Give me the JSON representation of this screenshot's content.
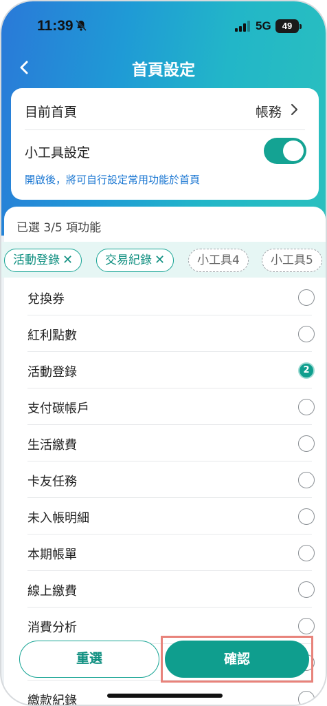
{
  "status_bar": {
    "time": "11:39",
    "network": "5G",
    "battery": "49",
    "icons": [
      "bell-muted-icon",
      "signal-icon"
    ]
  },
  "nav": {
    "title": "首頁設定",
    "back_icon": "chevron-left-icon"
  },
  "settings": {
    "home_label": "目前首頁",
    "home_value": "帳務",
    "widget_label": "小工具設定",
    "widget_enabled": true,
    "hint": "開啟後，將可自行設定常用功能於首頁"
  },
  "selection": {
    "count_text": "已選 3/5 項功能",
    "chips": [
      {
        "label": "活動登錄",
        "remove": "✕",
        "selected": true
      },
      {
        "label": "交易紀錄",
        "remove": "✕",
        "selected": true
      },
      {
        "label": "小工具4",
        "selected": false
      },
      {
        "label": "小工具5",
        "selected": false
      }
    ]
  },
  "features": [
    {
      "name": "兌換券",
      "checked": false
    },
    {
      "name": "紅利點數",
      "checked": false
    },
    {
      "name": "活動登錄",
      "checked": true,
      "order": "2"
    },
    {
      "name": "支付碳帳戶",
      "checked": false
    },
    {
      "name": "生活繳費",
      "checked": false
    },
    {
      "name": "卡友任務",
      "checked": false
    },
    {
      "name": "未入帳明細",
      "checked": false
    },
    {
      "name": "本期帳單",
      "checked": false
    },
    {
      "name": "線上繳費",
      "checked": false
    },
    {
      "name": "消費分析",
      "checked": false
    },
    {
      "name": "",
      "checked": false
    },
    {
      "name": "繳款紀錄",
      "checked": false
    }
  ],
  "buttons": {
    "reset": "重選",
    "confirm": "確認"
  },
  "colors": {
    "accent": "#0f9e8e",
    "link": "#1976d2",
    "highlight": "#e8837b"
  }
}
